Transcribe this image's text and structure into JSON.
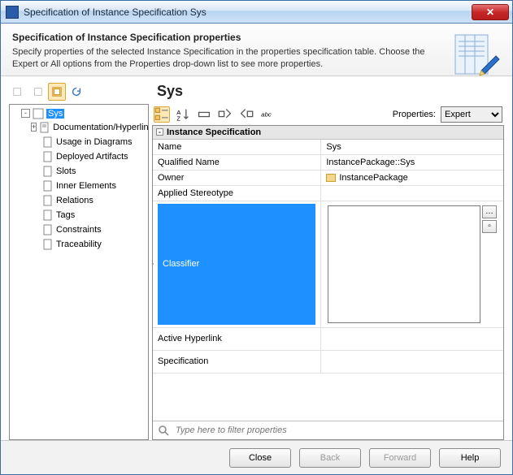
{
  "window": {
    "title": "Specification of Instance Specification Sys"
  },
  "header": {
    "title": "Specification of Instance Specification properties",
    "description": "Specify properties of the selected Instance Specification in the properties specification table. Choose the Expert or All options from the Properties drop-down list to see more properties."
  },
  "main_title": "Sys",
  "tree": {
    "root": "Sys",
    "items": [
      "Documentation/Hyperlinks",
      "Usage in Diagrams",
      "Deployed Artifacts",
      "Slots",
      "Inner Elements",
      "Relations",
      "Tags",
      "Constraints",
      "Traceability"
    ]
  },
  "properties_toolbar": {
    "label": "Properties:",
    "mode": "Expert"
  },
  "section_title": "Instance Specification",
  "rows": {
    "name": {
      "label": "Name",
      "value": "Sys"
    },
    "qualified": {
      "label": "Qualified Name",
      "value": "InstancePackage::Sys"
    },
    "owner": {
      "label": "Owner",
      "value": "InstancePackage"
    },
    "stereo": {
      "label": "Applied Stereotype",
      "value": ""
    },
    "classifier": {
      "label": "Classifier",
      "value": ""
    },
    "hyperlink": {
      "label": "Active Hyperlink",
      "value": ""
    },
    "spec": {
      "label": "Specification",
      "value": ""
    }
  },
  "filter": {
    "placeholder": "Type here to filter properties"
  },
  "footer": {
    "close": "Close",
    "back": "Back",
    "forward": "Forward",
    "help": "Help"
  }
}
